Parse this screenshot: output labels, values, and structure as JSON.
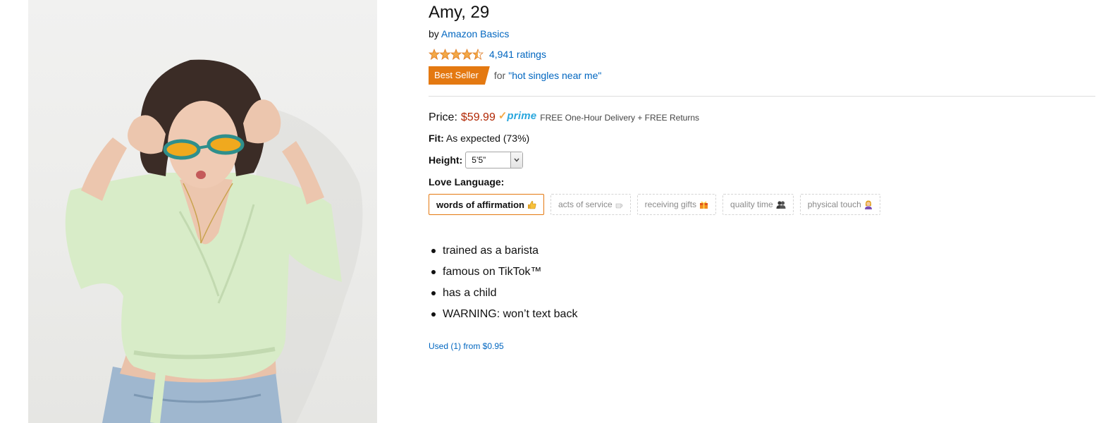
{
  "product": {
    "title": "Amy, 29",
    "by_prefix": "by",
    "brand": "Amazon Basics",
    "rating": 4.5,
    "rating_count": "4,941 ratings",
    "badge": "Best Seller",
    "badge_for": "for",
    "badge_category": "\"hot singles near me\""
  },
  "price": {
    "label": "Price:",
    "value": "$59.99",
    "prime_check": "✓",
    "prime_word": "prime",
    "delivery": "FREE One-Hour Delivery + FREE Returns"
  },
  "fit": {
    "label": "Fit:",
    "value": "As expected (73%)"
  },
  "height": {
    "label": "Height:",
    "selected": "5’5”"
  },
  "love_language": {
    "label": "Love Language:",
    "options": [
      {
        "label": "words of affirmation",
        "icon": "thumbs-up-emoji",
        "selected": true
      },
      {
        "label": "acts of service",
        "icon": "coffee-emoji",
        "selected": false
      },
      {
        "label": "receiving gifts",
        "icon": "gift-emoji",
        "selected": false
      },
      {
        "label": "quality time",
        "icon": "two-people-emoji",
        "selected": false
      },
      {
        "label": "physical touch",
        "icon": "person-emoji",
        "selected": false
      }
    ]
  },
  "bullets": [
    "trained as a barista",
    "famous on TikTok™",
    "has a child",
    "WARNING: won’t text back"
  ],
  "used": "Used (1) from $0.95",
  "colors": {
    "link": "#0066c0",
    "price": "#b12704",
    "badge": "#e47911",
    "prime": "#2aa7dd",
    "star": "#f3a847"
  }
}
